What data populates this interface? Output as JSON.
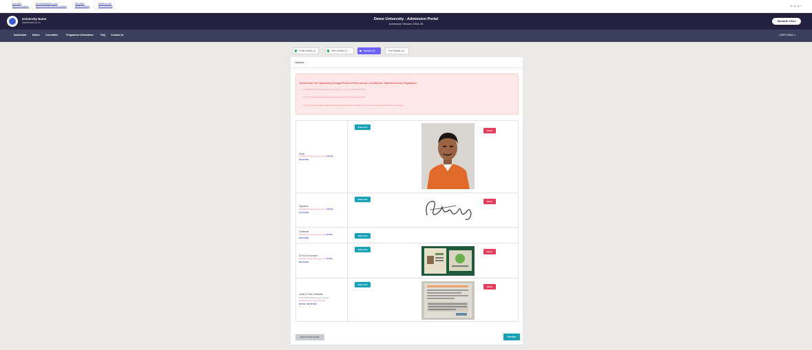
{
  "top_links": [
    {
      "line1": "Live Chat",
      "line2": "Recommendation"
    },
    {
      "line1": "Set My Password - Live",
      "line2": "Recommendation Recommended"
    },
    {
      "line1": "Raw Helpl",
      "line2": "Mobile Enabled"
    },
    {
      "line1": "Fastforms info",
      "line2": "Recommended"
    }
  ],
  "font_controls": "A  A  A+",
  "header": {
    "university_name": "University Name",
    "university_sub": "Dashboard as on",
    "portal_title": "Demo University - Admission Portal",
    "portal_sub": "Admission Session 2024-25",
    "brand": "Samarth eGov"
  },
  "nav": {
    "items": [
      "Dashboard",
      "Notice",
      "Committee",
      "Programme Information",
      "FAQ",
      "Contact Us"
    ],
    "user": "USER EMAIL ▾"
  },
  "tabs": [
    {
      "label": "Profile Details  (1)",
      "active": false
    },
    {
      "label": "Other Details  (2)",
      "active": false
    },
    {
      "label": "Uploads  (3)",
      "active": true
    },
    {
      "label": "Fee Payable  (4)",
      "active": false
    }
  ],
  "card": {
    "title": "Uploads",
    "instructions": {
      "title": "Instruction for Uploading Image/Photo of Document, Certificate, Marksheet and Signature",
      "items": [
        "1. Upload Photo and Signature as required in given image/pdf format.",
        "2. Size of images/documents should not exceed the limit mentioned.",
        "3. Documents/marksheets/certificates uploaded should be legible and as per format specified by the University."
      ]
    },
    "uploads": [
      {
        "name": "Photo",
        "req": "Accepted format: jpeg, jpg, png. ",
        "req_size": "(50 KB -",
        "req_size2": "200.00 KB)",
        "note": "",
        "has_delete": true,
        "image": "photo"
      },
      {
        "name": "Signature",
        "req": "Accepted format: jpeg, jpg, png. ",
        "req_size": "(20 KB -",
        "req_size2": "100.00 KB)",
        "note": "",
        "has_delete": true,
        "image": "signature"
      },
      {
        "name": "Certificate",
        "req": "Accepted format: jpeg, jpg, pdf. ",
        "req_size": "(50 KB -",
        "req_size2": "200.00 KB)",
        "note": "",
        "has_delete": false,
        "image": ""
      },
      {
        "name": "ID Proof Document",
        "req": "Accepted format: jpeg, jpg, pdf. ",
        "req_size": "(50 KB -",
        "req_size2": "200.00 KB)",
        "note": "",
        "has_delete": true,
        "image": "id"
      },
      {
        "name": "Caste & Tribe Certificate",
        "req": "Accepted format: jpeg, jpg, pdf. ",
        "req_size": "(50 KB -",
        "req_size2": "200.00 KB)",
        "note": "SC/ST/OBC/EWS Category Issued",
        "has_delete": true,
        "image": "doc"
      }
    ],
    "select_label": "Select File",
    "delete_label": "Delete",
    "back_label": "Back to Profile Details",
    "preview_label": "Preview"
  }
}
